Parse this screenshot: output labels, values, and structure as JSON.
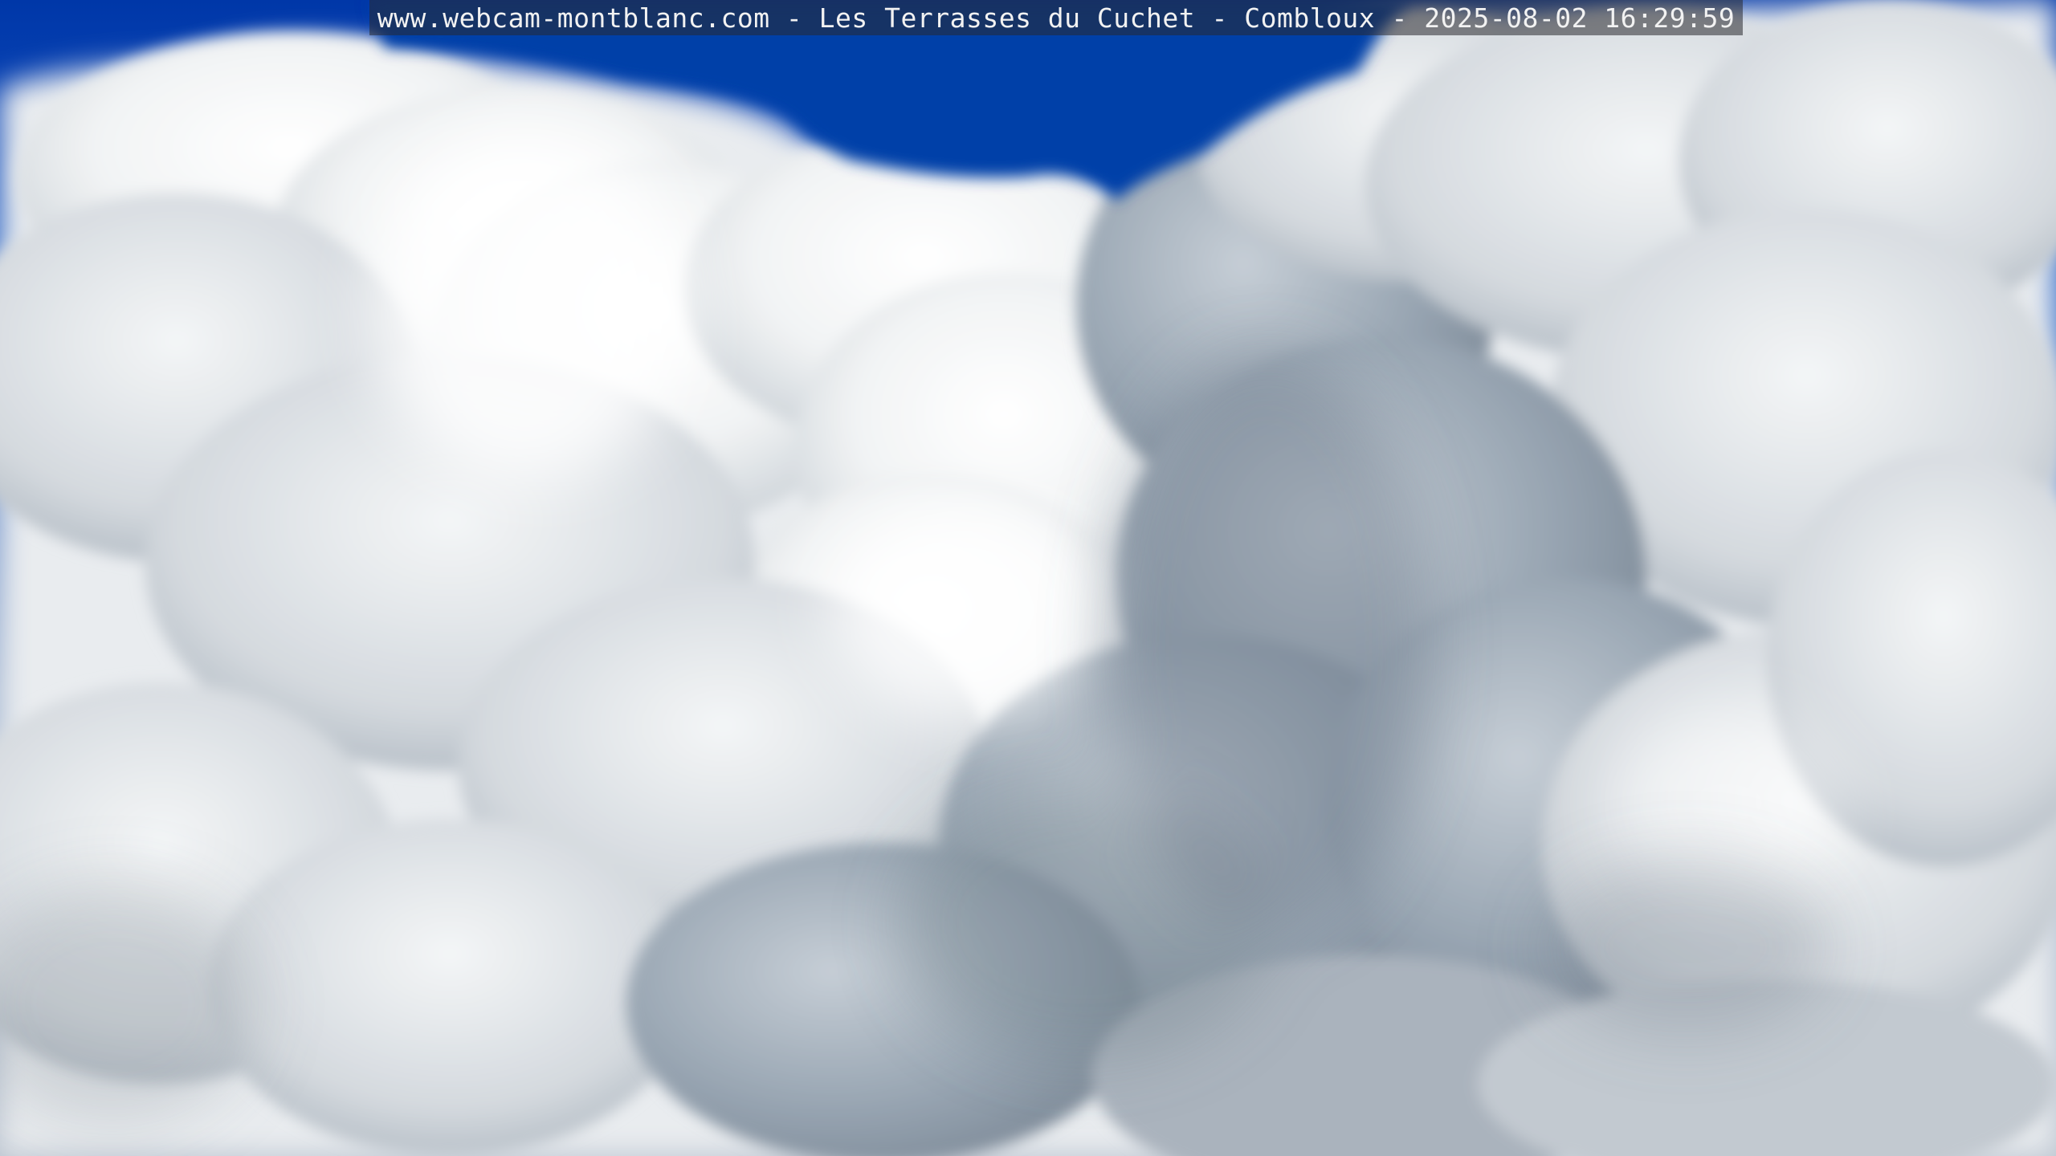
{
  "overlay": {
    "caption": "www.webcam-montblanc.com - Les Terrasses du Cuchet - Combloux - 2025-08-02 16:29:59"
  },
  "scene": {
    "subject": "cumulus-clouds",
    "sky_color": "#0a46b8",
    "cloud_highlight_color": "#ffffff",
    "cloud_shadow_color": "#6f7d8c"
  }
}
